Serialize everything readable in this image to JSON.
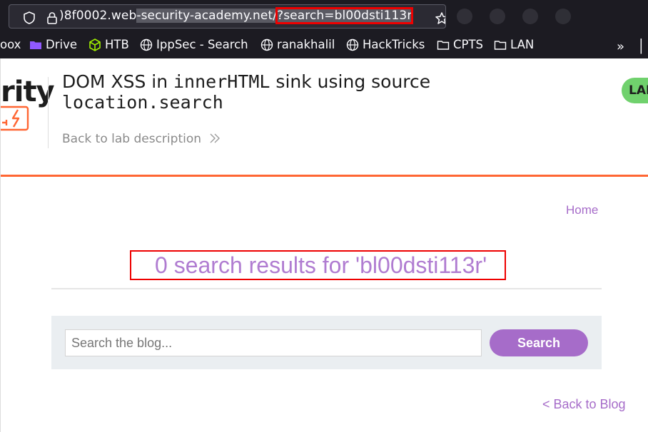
{
  "browser": {
    "url_prefix": ")8f0002.web",
    "url_selected": "-security-academy.net/",
    "url_highlight": "?search=bl00dsti113r",
    "bookmarks": [
      {
        "label": "oox",
        "icon": "folder-icon"
      },
      {
        "label": "Drive",
        "icon": "folder-icon"
      },
      {
        "label": "HTB",
        "icon": "hackthebox-icon"
      },
      {
        "label": "IppSec - Search",
        "icon": "globe-icon"
      },
      {
        "label": "ranakhalil",
        "icon": "globe-icon"
      },
      {
        "label": "HackTricks",
        "icon": "globe-icon"
      },
      {
        "label": "CPTS",
        "icon": "folder-icon"
      },
      {
        "label": "LAN",
        "icon": "folder-icon"
      }
    ],
    "overflow_label": "»"
  },
  "header": {
    "logo_text": "rity",
    "title_part1": "DOM XSS in ",
    "title_code1": "innerHTML",
    "title_part2": " sink using source",
    "title_code2": "location.search",
    "back_link": "Back to lab description",
    "badge": "LAB"
  },
  "nav": {
    "home": "Home"
  },
  "main": {
    "results_text": "0 search results for 'bl00dsti113r'",
    "search_placeholder": "Search the blog...",
    "search_button": "Search",
    "back_to_blog": "< Back to Blog"
  },
  "colors": {
    "accent": "#a66cc9",
    "brand_orange": "#ff6633",
    "badge_green": "#70d16d",
    "highlight_box": "#ee0000"
  }
}
